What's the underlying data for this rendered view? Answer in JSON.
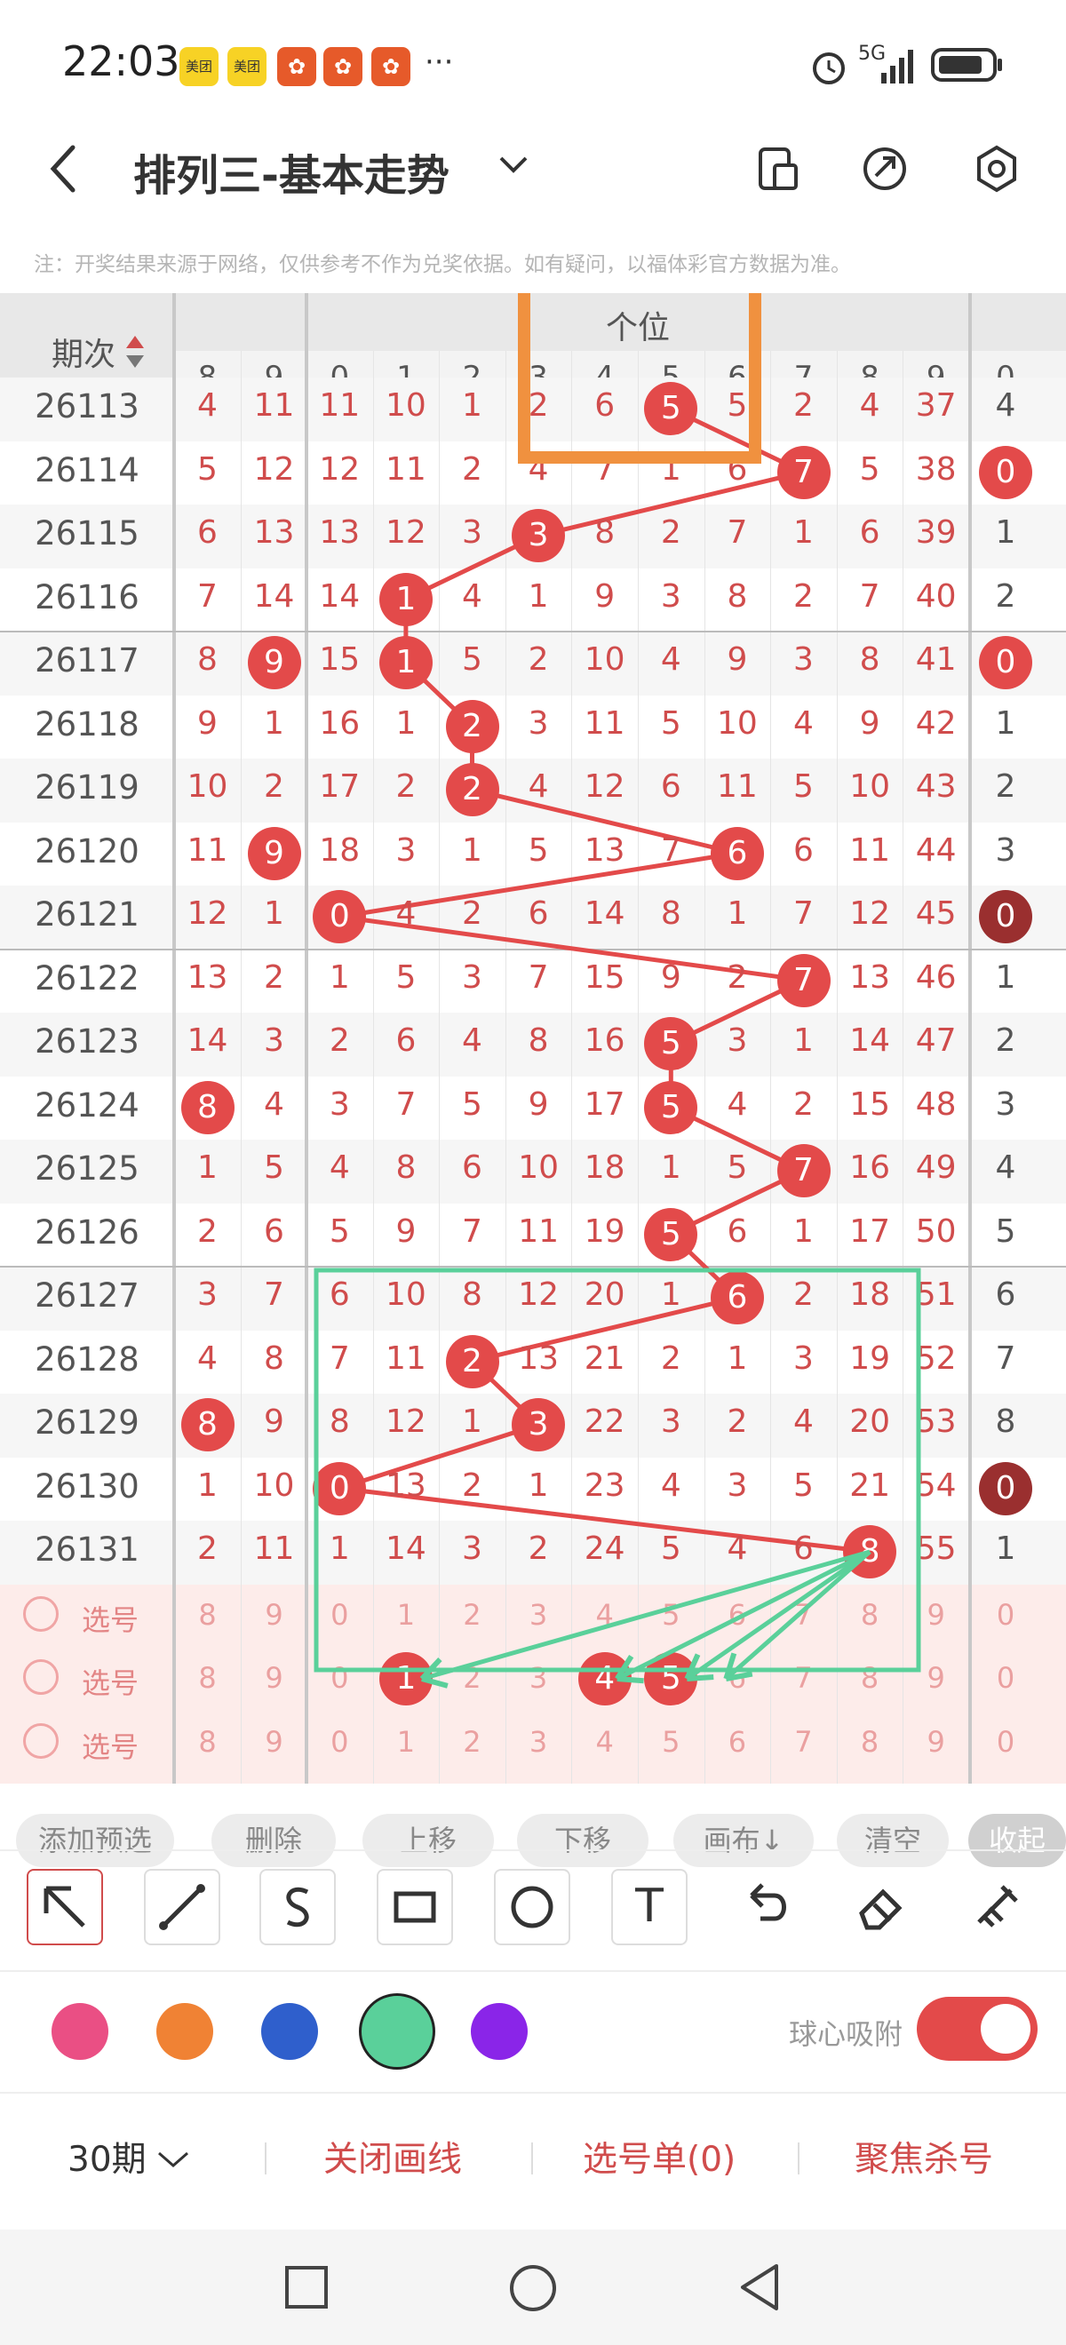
{
  "status_bar": {
    "time": "22:03",
    "notif_meituan": "美团",
    "more": "···",
    "network": "5G"
  },
  "header": {
    "title": "排列三-基本走势",
    "icons": [
      "back-icon",
      "chevron-down-icon",
      "phone-icon",
      "share-icon",
      "settings-icon"
    ]
  },
  "notice": "注：开奖结果来源于网络，仅供参考不作为兑奖依据。如有疑问，以福体彩官方数据为准。",
  "table": {
    "period_label": "期次",
    "group_label": "个位",
    "left_digits": [
      "8",
      "9"
    ],
    "digits": [
      "0",
      "1",
      "2",
      "3",
      "4",
      "5",
      "6",
      "7",
      "8",
      "9"
    ],
    "right_digits": [
      "0"
    ],
    "rows": [
      {
        "period": "26113",
        "left": [
          "4",
          "11"
        ],
        "cells": [
          "11",
          "10",
          "1",
          "2",
          "6",
          "5",
          "5",
          "2",
          "4",
          "37"
        ],
        "ball": 5,
        "right": "4"
      },
      {
        "period": "26114",
        "left": [
          "5",
          "12"
        ],
        "cells": [
          "12",
          "11",
          "2",
          "4",
          "7",
          "1",
          "6",
          "7",
          "5",
          "38"
        ],
        "ball": 7,
        "right": "0",
        "right_ball": true
      },
      {
        "period": "26115",
        "left": [
          "6",
          "13"
        ],
        "cells": [
          "13",
          "12",
          "3",
          "3",
          "8",
          "2",
          "7",
          "1",
          "6",
          "39"
        ],
        "ball": 3,
        "right": "1"
      },
      {
        "period": "26116",
        "left": [
          "7",
          "14"
        ],
        "cells": [
          "14",
          "1",
          "4",
          "1",
          "9",
          "3",
          "8",
          "2",
          "7",
          "40"
        ],
        "ball": 1,
        "right": "2"
      },
      {
        "period": "26117",
        "left": [
          "8",
          "9"
        ],
        "left_ball": 1,
        "cells": [
          "15",
          "1",
          "5",
          "2",
          "10",
          "4",
          "9",
          "3",
          "8",
          "41"
        ],
        "ball": 1,
        "right": "0",
        "right_ball": true
      },
      {
        "period": "26118",
        "left": [
          "9",
          "1"
        ],
        "cells": [
          "16",
          "1",
          "2",
          "3",
          "11",
          "5",
          "10",
          "4",
          "9",
          "42"
        ],
        "ball": 2,
        "right": "1"
      },
      {
        "period": "26119",
        "left": [
          "10",
          "2"
        ],
        "cells": [
          "17",
          "2",
          "2",
          "4",
          "12",
          "6",
          "11",
          "5",
          "10",
          "43"
        ],
        "ball": 2,
        "right": "2"
      },
      {
        "period": "26120",
        "left": [
          "11",
          "9"
        ],
        "left_ball": 1,
        "cells": [
          "18",
          "3",
          "1",
          "5",
          "13",
          "7",
          "6",
          "6",
          "11",
          "44"
        ],
        "ball": 6,
        "right": "3"
      },
      {
        "period": "26121",
        "left": [
          "12",
          "1"
        ],
        "cells": [
          "0",
          "4",
          "2",
          "6",
          "14",
          "8",
          "1",
          "7",
          "12",
          "45"
        ],
        "ball": 0,
        "right": "0",
        "right_ball": true,
        "right_dark": true
      },
      {
        "period": "26122",
        "left": [
          "13",
          "2"
        ],
        "cells": [
          "1",
          "5",
          "3",
          "7",
          "15",
          "9",
          "2",
          "7",
          "13",
          "46"
        ],
        "ball": 7,
        "right": "1"
      },
      {
        "period": "26123",
        "left": [
          "14",
          "3"
        ],
        "cells": [
          "2",
          "6",
          "4",
          "8",
          "16",
          "5",
          "3",
          "1",
          "14",
          "47"
        ],
        "ball": 5,
        "right": "2"
      },
      {
        "period": "26124",
        "left": [
          "8",
          "4"
        ],
        "left_ball": 0,
        "cells": [
          "3",
          "7",
          "5",
          "9",
          "17",
          "5",
          "4",
          "2",
          "15",
          "48"
        ],
        "ball": 5,
        "right": "3"
      },
      {
        "period": "26125",
        "left": [
          "1",
          "5"
        ],
        "cells": [
          "4",
          "8",
          "6",
          "10",
          "18",
          "1",
          "5",
          "7",
          "16",
          "49"
        ],
        "ball": 7,
        "right": "4"
      },
      {
        "period": "26126",
        "left": [
          "2",
          "6"
        ],
        "cells": [
          "5",
          "9",
          "7",
          "11",
          "19",
          "5",
          "6",
          "1",
          "17",
          "50"
        ],
        "ball": 5,
        "right": "5"
      },
      {
        "period": "26127",
        "left": [
          "3",
          "7"
        ],
        "cells": [
          "6",
          "10",
          "8",
          "12",
          "20",
          "1",
          "6",
          "2",
          "18",
          "51"
        ],
        "ball": 6,
        "right": "6"
      },
      {
        "period": "26128",
        "left": [
          "4",
          "8"
        ],
        "cells": [
          "7",
          "11",
          "2",
          "13",
          "21",
          "2",
          "1",
          "3",
          "19",
          "52"
        ],
        "ball": 2,
        "right": "7"
      },
      {
        "period": "26129",
        "left": [
          "8",
          "9"
        ],
        "left_ball": 0,
        "cells": [
          "8",
          "12",
          "1",
          "3",
          "22",
          "3",
          "2",
          "4",
          "20",
          "53"
        ],
        "ball": 3,
        "right": "8"
      },
      {
        "period": "26130",
        "left": [
          "1",
          "10"
        ],
        "cells": [
          "0",
          "13",
          "2",
          "1",
          "23",
          "4",
          "3",
          "5",
          "21",
          "54"
        ],
        "ball": 0,
        "right": "0",
        "right_ball": true,
        "right_dark": true
      },
      {
        "period": "26131",
        "left": [
          "2",
          "11"
        ],
        "cells": [
          "1",
          "14",
          "3",
          "2",
          "24",
          "5",
          "4",
          "6",
          "8",
          "55"
        ],
        "ball": 8,
        "right": "1"
      }
    ],
    "pick_rows": [
      {
        "label": "选号",
        "balls": []
      },
      {
        "label": "选号",
        "balls": [
          1,
          4,
          5
        ]
      },
      {
        "label": "选号",
        "balls": []
      }
    ]
  },
  "action_pills": [
    "添加预选",
    "删除",
    "上移",
    "下移",
    "画布↓",
    "清空",
    "收起"
  ],
  "tools": [
    "arrow-tool-icon",
    "line-tool-icon",
    "curve-tool-icon",
    "rect-tool-icon",
    "circle-tool-icon",
    "text-tool-icon",
    "undo-icon",
    "eraser-icon",
    "brush-icon"
  ],
  "tool_text_glyph": "T",
  "colors": {
    "accent": "#e34a4a",
    "dark_ball": "#9a2f2f",
    "overlay_orange": "#f0913f",
    "overlay_green": "#5ad09a",
    "swatches": [
      "#ea4f84",
      "#f08234",
      "#2f5fcc",
      "#5ad09a",
      "#8a25e8"
    ]
  },
  "snap_label": "球心吸附",
  "bottom_bar": {
    "period_select": "30期",
    "close_lines": "关闭画线",
    "pick_list": "选号单(0)",
    "focus_kill": "聚焦杀号"
  }
}
